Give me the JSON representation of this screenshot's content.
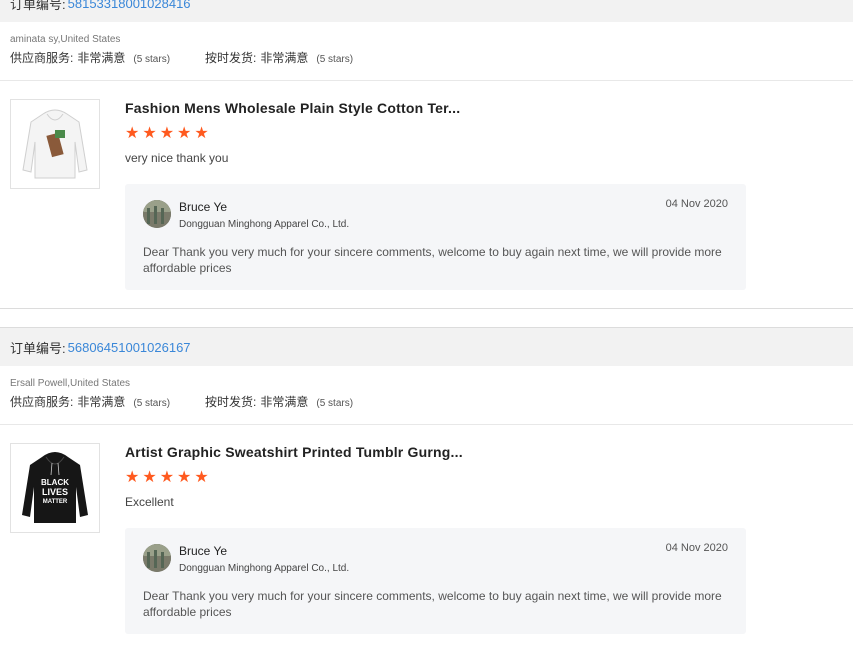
{
  "colors": {
    "accent_link": "#3a87d8",
    "star": "#ff5a1f",
    "reply_bg": "#f5f6f8"
  },
  "orders": [
    {
      "label": "订单编号:",
      "number": "58153318001028416",
      "buyer": "aminata sy,United States",
      "ratings": [
        {
          "label": "供应商服务:",
          "value": "非常满意",
          "stars": "(5 stars)"
        },
        {
          "label": "按时发货:",
          "value": "非常满意",
          "stars": "(5 stars)"
        }
      ],
      "product_icon": "white-hoodie-image",
      "title": "Fashion Mens Wholesale Plain Style Cotton Ter...",
      "star_count": 5,
      "comment": "very nice thank you",
      "reply": {
        "seller_name": "Bruce Ye",
        "company": "Dongguan Minghong Apparel Co., Ltd.",
        "date": "04 Nov 2020",
        "text": "Dear Thank you very much for your sincere comments, welcome to buy again next time, we will provide more affordable prices"
      }
    },
    {
      "label": "订单编号:",
      "number": "56806451001026167",
      "buyer": "Ersall Powell,United States",
      "ratings": [
        {
          "label": "供应商服务:",
          "value": "非常满意",
          "stars": "(5 stars)"
        },
        {
          "label": "按时发货:",
          "value": "非常满意",
          "stars": "(5 stars)"
        }
      ],
      "product_icon": "black-hoodie-image",
      "product_print": [
        "BLACK",
        "LIVES",
        "MATTER"
      ],
      "title": "Artist Graphic Sweatshirt Printed Tumblr Gurng...",
      "star_count": 5,
      "comment": "Excellent",
      "reply": {
        "seller_name": "Bruce Ye",
        "company": "Dongguan Minghong Apparel Co., Ltd.",
        "date": "04 Nov 2020",
        "text": "Dear Thank you very much for your sincere comments, welcome to buy again next time, we will provide more affordable prices"
      }
    }
  ]
}
